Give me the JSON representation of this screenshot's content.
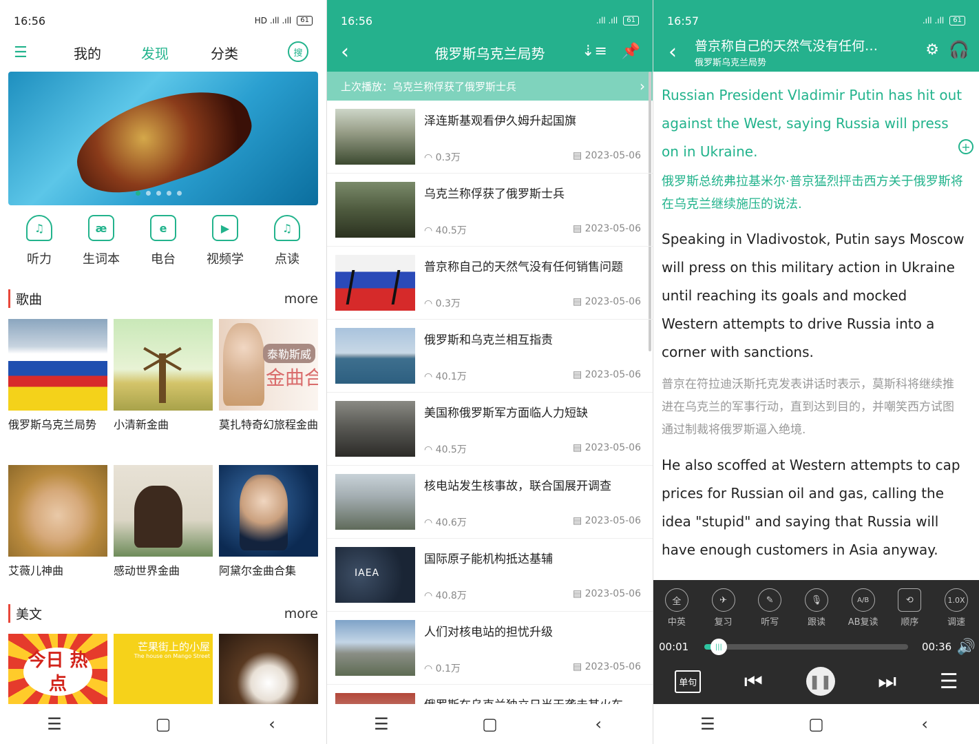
{
  "screen1": {
    "status": {
      "time": "16:56",
      "icons": "⏰",
      "signal": "HD .ıll .ıll",
      "battery": "61"
    },
    "tabs": {
      "mine": "我的",
      "discover": "发现",
      "category": "分类"
    },
    "search_icon_text": "搜",
    "quick_actions": [
      {
        "label": "听力",
        "glyph": "♫"
      },
      {
        "label": "生词本",
        "glyph": "æ"
      },
      {
        "label": "电台",
        "glyph": "e"
      },
      {
        "label": "视频学",
        "glyph": "▶"
      },
      {
        "label": "点读",
        "glyph": "♫"
      }
    ],
    "songs_section": {
      "title": "歌曲",
      "more": "more"
    },
    "songs": [
      {
        "caption": "俄罗斯乌克兰局势"
      },
      {
        "caption": "小清新金曲"
      },
      {
        "caption": "莫扎特奇幻旅程金曲",
        "overlay_top": "泰勒斯威",
        "overlay_big": "金曲合"
      },
      {
        "caption": "艾薇儿神曲"
      },
      {
        "caption": "感动世界金曲"
      },
      {
        "caption": "阿黛尔金曲合集"
      }
    ],
    "prose_section": {
      "title": "美文",
      "more": "more"
    },
    "prose": [
      {
        "overlay": "今日 热点"
      },
      {
        "overlay": "芒果街上的小屋",
        "overlay_sub": "The house on Mango Street"
      },
      {
        "overlay": ""
      }
    ],
    "accent_color": "#22b38c"
  },
  "screen2": {
    "status": {
      "time": "16:56",
      "battery": "61"
    },
    "title": "俄罗斯乌克兰局势",
    "last_played": "上次播放：乌克兰称俘获了俄罗斯士兵",
    "items": [
      {
        "title": "泽连斯基观看伊久姆升起国旗",
        "plays": "0.3万",
        "date": "2023-05-06"
      },
      {
        "title": "乌克兰称俘获了俄罗斯士兵",
        "plays": "40.5万",
        "date": "2023-05-06"
      },
      {
        "title": "普京称自己的天然气没有任何销售问题",
        "plays": "0.3万",
        "date": "2023-05-06"
      },
      {
        "title": "俄罗斯和乌克兰相互指责",
        "plays": "40.1万",
        "date": "2023-05-06"
      },
      {
        "title": "美国称俄罗斯军方面临人力短缺",
        "plays": "40.5万",
        "date": "2023-05-06"
      },
      {
        "title": "核电站发生核事故，联合国展开调查",
        "plays": "40.6万",
        "date": "2023-05-06"
      },
      {
        "title": "国际原子能机构抵达基辅",
        "plays": "40.8万",
        "date": "2023-05-06",
        "thumb_text": "IAEA"
      },
      {
        "title": "人们对核电站的担忧升级",
        "plays": "0.1万",
        "date": "2023-05-06"
      },
      {
        "title": "俄罗斯在乌克兰独立日当天袭击其火车",
        "plays": "",
        "date": ""
      }
    ]
  },
  "screen3": {
    "status": {
      "time": "16:57",
      "battery": "61"
    },
    "title": "普京称自己的天然气没有任何…",
    "subtitle": "俄罗斯乌克兰局势",
    "headline_en": "Russian President Vladimir Putin has hit out against the West, saying Russia will press on in Ukraine.",
    "headline_zh": "俄罗斯总统弗拉基米尔·普京猛烈抨击西方关于俄罗斯将在乌克兰继续施压的说法.",
    "para1_en": "Speaking in Vladivostok, Putin says Moscow will press on this military action in Ukraine until reaching its goals and mocked Western attempts to drive Russia into a corner with sanctions.",
    "para1_zh": "普京在符拉迪沃斯托克发表讲话时表示，莫斯科将继续推进在乌克兰的军事行动，直到达到目的，并嘲笑西方试图通过制裁将俄罗斯逼入绝境.",
    "para2_en": "He also scoffed at Western attempts to cap prices for Russian oil and gas, calling the idea \"stupid\" and saying that Russia will have enough customers in Asia anyway.",
    "tools": [
      {
        "label": "中英",
        "glyph": "全"
      },
      {
        "label": "复习",
        "glyph": "✈"
      },
      {
        "label": "听写",
        "glyph": "✎"
      },
      {
        "label": "跟读",
        "glyph": "🎙"
      },
      {
        "label": "AB复读",
        "glyph": "A/B"
      },
      {
        "label": "顺序",
        "glyph": "⟲"
      },
      {
        "label": "调速",
        "glyph": "1.0X"
      }
    ],
    "player": {
      "elapsed": "00:01",
      "total": "00:36",
      "progress": 0.03,
      "single_label": "单句"
    }
  }
}
